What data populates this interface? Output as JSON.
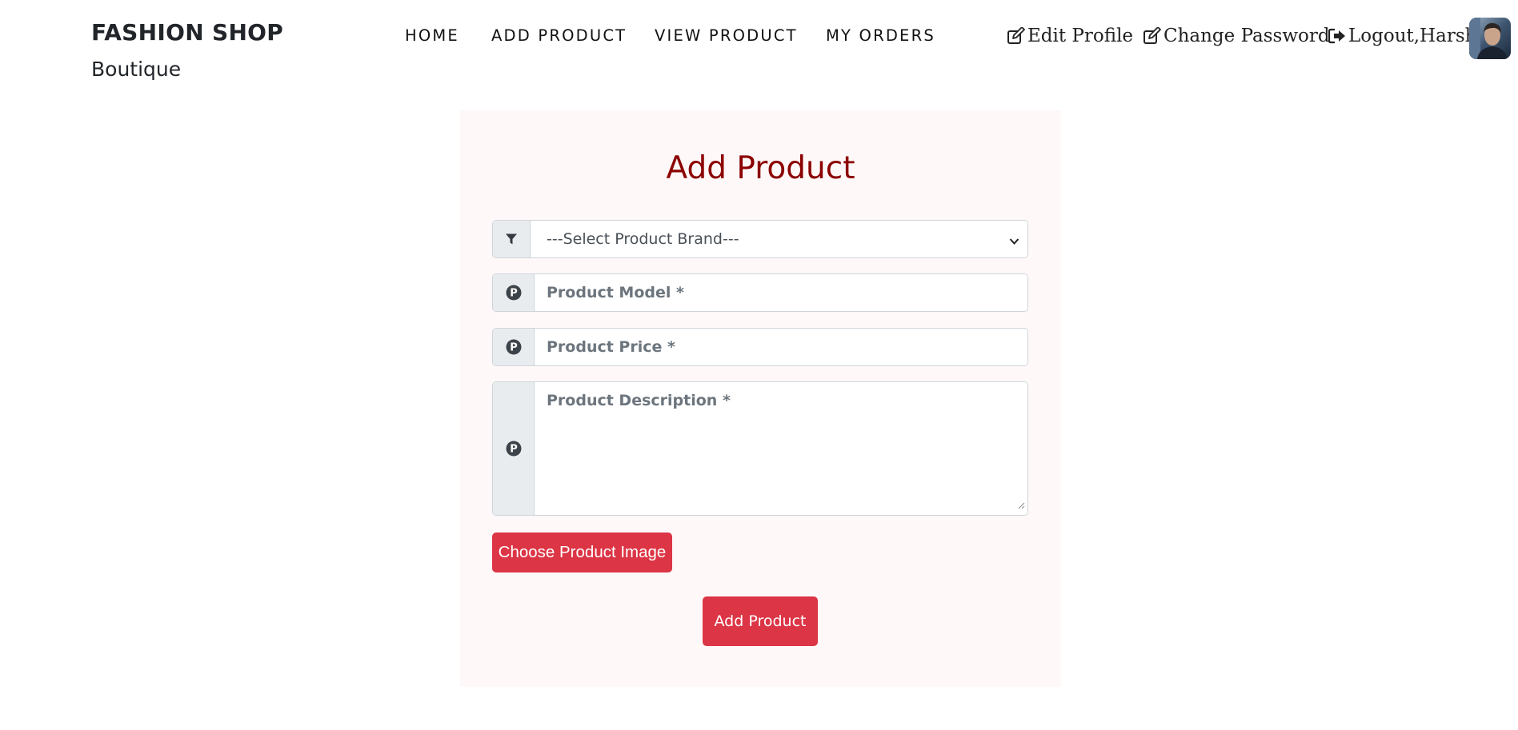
{
  "brand": {
    "title": "FASHION SHOP",
    "subtitle": "Boutique"
  },
  "nav": {
    "home": "HOME",
    "add_product": "ADD PRODUCT",
    "view_product": "VIEW PRODUCT",
    "my_orders": "MY ORDERS"
  },
  "user_menu": {
    "edit_profile": "Edit Profile",
    "change_password": "Change Password",
    "logout": "Logout,Harsh",
    "icons": [
      "edit-icon",
      "edit-icon",
      "logout-icon"
    ]
  },
  "form": {
    "title": "Add Product",
    "brand_select": {
      "selected": "---Select Product Brand---",
      "options": [
        "---Select Product Brand---"
      ],
      "icon": "filter-icon"
    },
    "model_placeholder": "Product Model *",
    "price_placeholder": "Product Price *",
    "description_placeholder": "Product Description *",
    "field_icon": "parking-circle-icon",
    "choose_image_label": "Choose Product Image",
    "submit_label": "Add Product"
  },
  "colors": {
    "accent_red": "#dc3545",
    "title_red": "#8b0000",
    "card_background": "#fff8f8",
    "addon_background": "#e9ecef"
  }
}
